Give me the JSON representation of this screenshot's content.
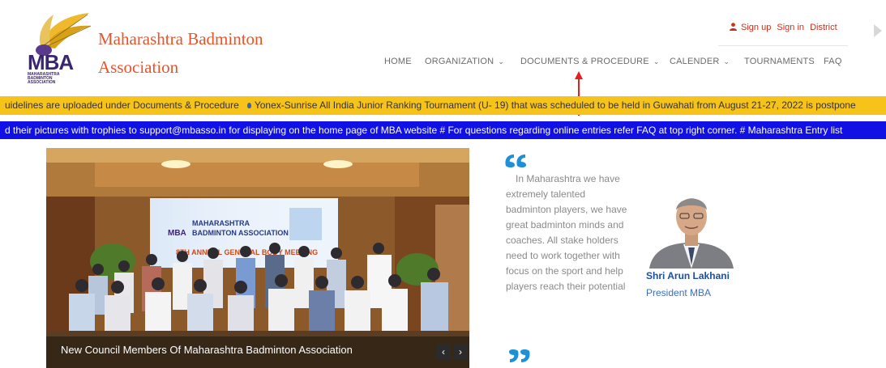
{
  "brand": {
    "line1": "Maharashtra Badminton",
    "line2": "Association",
    "logo_text": "MBA",
    "logo_sub": "MAHARASHTRA BADMINTON ASSOCIATION"
  },
  "top_links": {
    "sign_up": "Sign up",
    "sign_in": "Sign in",
    "district": "District"
  },
  "nav": {
    "home": "HOME",
    "organization": "ORGANIZATION",
    "documents": "DOCUMENTS & PROCEDURE",
    "calender": "CALENDER",
    "tournaments": "TOURNAMENTS",
    "faq": "FAQ"
  },
  "ticker1": {
    "part1": "uidelines are uploaded under Documents & Procedure",
    "part2": "Yonex-Sunrise All India Junior Ranking Tournament (U- 19) that was scheduled to be held in Guwahati from August 21-27, 2022 is postpone"
  },
  "ticker2": {
    "text": "d their pictures with trophies to support@mbasso.in for displaying on the home page of MBA website # For questions regarding online entries refer FAQ at top right corner. # Maharashtra Entry list"
  },
  "slider": {
    "caption": "New Council Members Of Maharashtra Badminton Association",
    "prev_label": "‹",
    "next_label": "›",
    "banner_line1": "MAHARASHTRA",
    "banner_line2": "BADMINTON ASSOCIATION",
    "banner_logo": "MBA",
    "banner_event": "8TH ANNUAL GENERAL BODY MEETING"
  },
  "quote": {
    "text": "In Maharashtra we have extremely talented badminton players, we have great badminton minds and coaches. All stake holders need to work together with focus on the sport and help players reach their potential"
  },
  "president": {
    "name": "Shri Arun Lakhani",
    "title": "President MBA"
  },
  "colors": {
    "brand_orange": "#e8542a",
    "link_red": "#c8301c",
    "ticker_yellow": "#f6c31b",
    "ticker_blue": "#1111e6",
    "quote_blue": "#1f8fd6",
    "name_blue": "#1b4fa3"
  }
}
